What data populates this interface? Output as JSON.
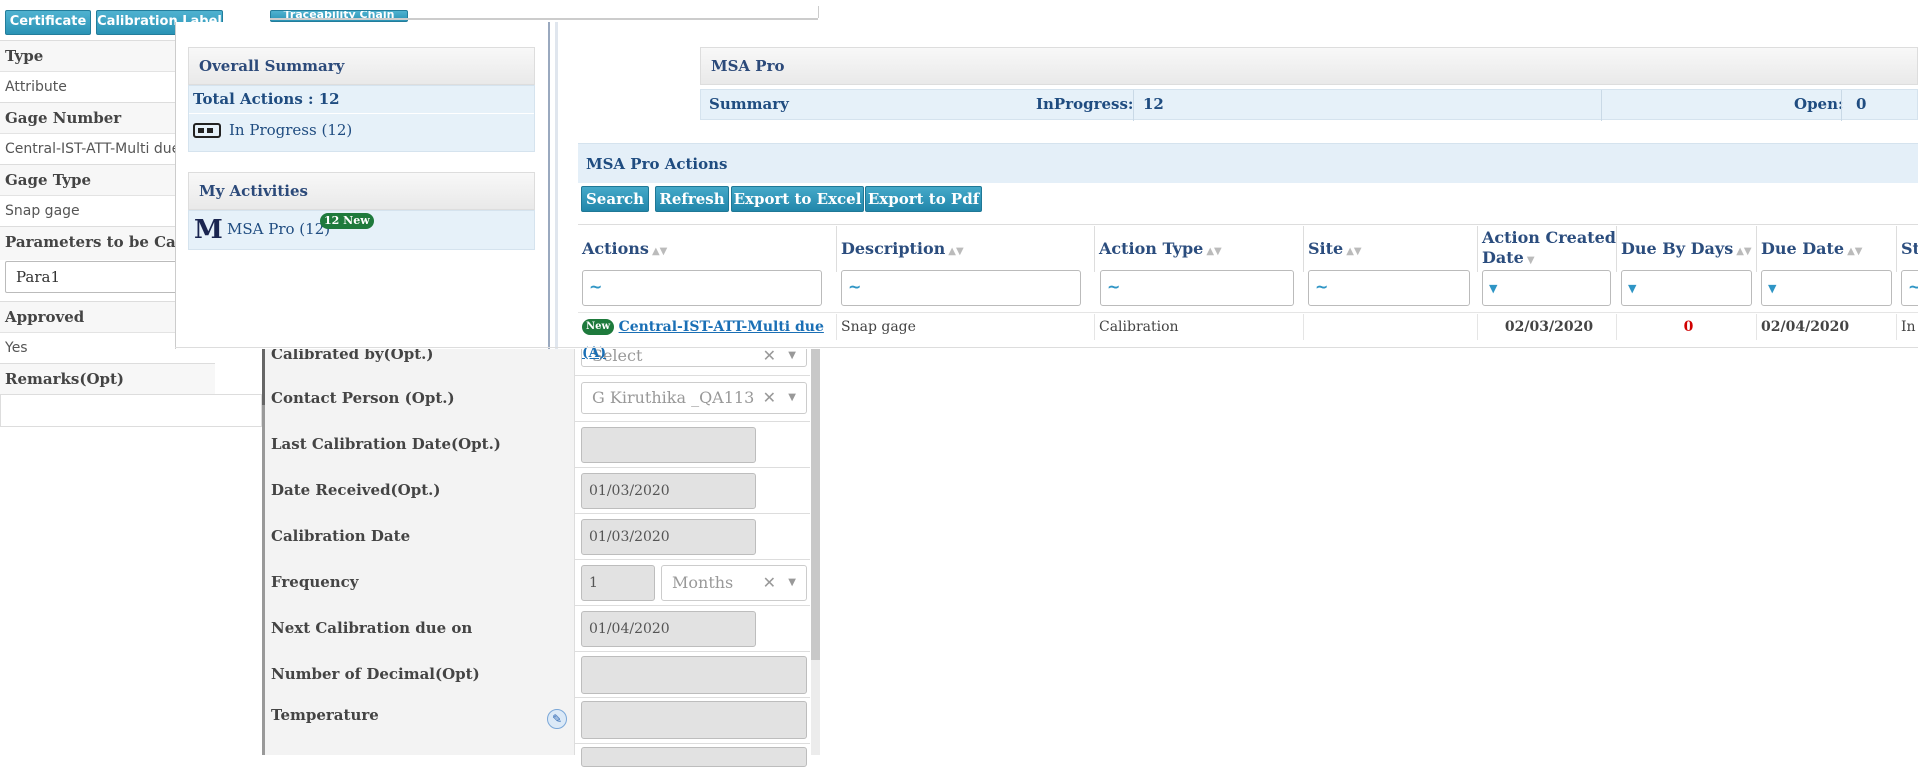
{
  "top_buttons": {
    "certificate": "Certificate",
    "calibration_label": "Calibration Label",
    "traceability_chain": "Traceability Chain"
  },
  "left_details": {
    "type_label": "Type",
    "type_value": "Attribute",
    "gage_number_label": "Gage Number",
    "gage_number_value": "Central-IST-ATT-Multi due",
    "gage_type_label": "Gage Type",
    "gage_type_value": "Snap gage",
    "params_label": "Parameters to be Calib",
    "params_value": "Para1",
    "approved_label": "Approved",
    "approved_value": "Yes",
    "remarks_label": "Remarks(Opt)"
  },
  "form": {
    "calibrated_by_label": "Calibrated by(Opt.)",
    "calibrated_by_placeholder": "Select",
    "contact_person_label": "Contact Person (Opt.)",
    "contact_person_value": "G Kiruthika _QA113",
    "last_cal_label": "Last Calibration Date(Opt.)",
    "last_cal_value": "",
    "date_received_label": "Date Received(Opt.)",
    "date_received_value": "01/03/2020",
    "cal_date_label": "Calibration Date",
    "cal_date_value": "01/03/2020",
    "frequency_label": "Frequency",
    "frequency_value": "1",
    "frequency_unit": "Months",
    "next_due_label": "Next Calibration due on",
    "next_due_value": "01/04/2020",
    "decimal_label": "Number of Decimal(Opt)",
    "decimal_value": "",
    "temperature_label": "Temperature",
    "temperature_value": ""
  },
  "overall_summary": {
    "title": "Overall Summary",
    "total_actions": "Total Actions : 12",
    "in_progress": "In Progress (12)"
  },
  "my_activities": {
    "title": "My Activities",
    "item": "MSA Pro (12)",
    "badge": "12 New"
  },
  "msa_pro": {
    "title": "MSA Pro",
    "summary_label": "Summary",
    "inprogress_label": "InProgress:",
    "inprogress_value": "12",
    "open_label": "Open:",
    "open_value": "0"
  },
  "actions_panel": {
    "title": "MSA Pro Actions",
    "buttons": [
      "Search",
      "Refresh",
      "Export to Excel",
      "Export to Pdf"
    ],
    "columns": [
      "Actions",
      "Description",
      "Action Type",
      "Site",
      "Action Created Date",
      "Due By Days",
      "Due Date",
      "St"
    ],
    "filter_symbol": "~",
    "row": {
      "badge": "New",
      "action": "Central-IST-ATT-Multi due (A)",
      "description": "Snap gage",
      "action_type": "Calibration",
      "site": "",
      "created": "02/03/2020",
      "due_days": "0",
      "due_date": "02/04/2020",
      "status": "In"
    }
  },
  "colors": {
    "accent": "#2a93b5",
    "header_text": "#2b4d7e",
    "panel_bg": "#e6f1f9",
    "badge_green": "#1e7a3c",
    "alert_red": "#d00000"
  }
}
